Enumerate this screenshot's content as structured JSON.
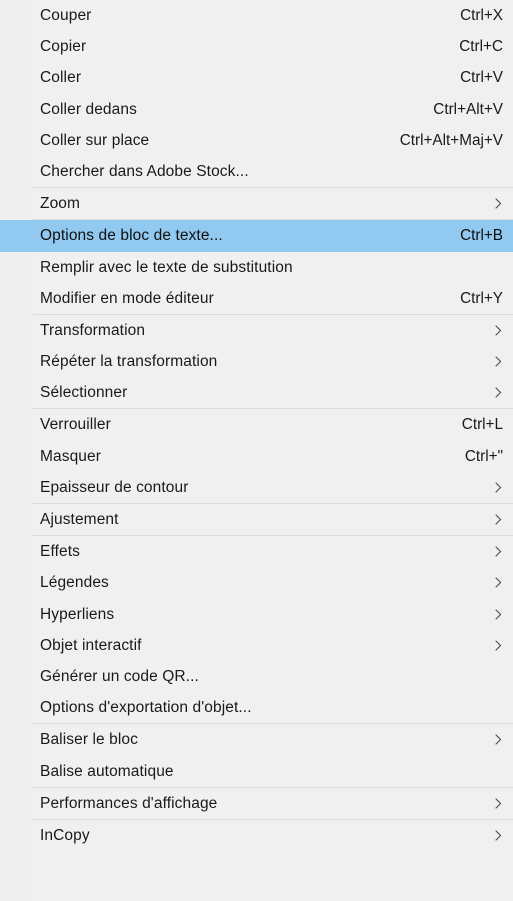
{
  "menu": {
    "type": "context-menu",
    "app": "Adobe InDesign",
    "language": "fr-FR",
    "background_color": "#f0f0f0",
    "highlight_color": "#91c9f0",
    "separator_color": "#dcdcdc",
    "text_color": "#1a1a1a",
    "chevron_glyph": "›",
    "items": [
      {
        "label": "Couper",
        "accel": "Ctrl+X",
        "submenu": false,
        "separator_after": false,
        "selected": false
      },
      {
        "label": "Copier",
        "accel": "Ctrl+C",
        "submenu": false,
        "separator_after": false,
        "selected": false
      },
      {
        "label": "Coller",
        "accel": "Ctrl+V",
        "submenu": false,
        "separator_after": false,
        "selected": false
      },
      {
        "label": "Coller dedans",
        "accel": "Ctrl+Alt+V",
        "submenu": false,
        "separator_after": false,
        "selected": false
      },
      {
        "label": "Coller sur place",
        "accel": "Ctrl+Alt+Maj+V",
        "submenu": false,
        "separator_after": false,
        "selected": false
      },
      {
        "label": "Chercher dans Adobe Stock...",
        "accel": "",
        "submenu": false,
        "separator_after": true,
        "selected": false
      },
      {
        "label": "Zoom",
        "accel": "",
        "submenu": true,
        "separator_after": true,
        "selected": false
      },
      {
        "label": "Options de bloc de texte...",
        "accel": "Ctrl+B",
        "submenu": false,
        "separator_after": false,
        "selected": true
      },
      {
        "label": "Remplir avec le texte de substitution",
        "accel": "",
        "submenu": false,
        "separator_after": false,
        "selected": false
      },
      {
        "label": "Modifier en mode éditeur",
        "accel": "Ctrl+Y",
        "submenu": false,
        "separator_after": true,
        "selected": false
      },
      {
        "label": "Transformation",
        "accel": "",
        "submenu": true,
        "separator_after": false,
        "selected": false
      },
      {
        "label": "Répéter la transformation",
        "accel": "",
        "submenu": true,
        "separator_after": false,
        "selected": false
      },
      {
        "label": "Sélectionner",
        "accel": "",
        "submenu": true,
        "separator_after": true,
        "selected": false
      },
      {
        "label": "Verrouiller",
        "accel": "Ctrl+L",
        "submenu": false,
        "separator_after": false,
        "selected": false
      },
      {
        "label": "Masquer",
        "accel": "Ctrl+\"",
        "submenu": false,
        "separator_after": false,
        "selected": false
      },
      {
        "label": "Epaisseur de contour",
        "accel": "",
        "submenu": true,
        "separator_after": true,
        "selected": false
      },
      {
        "label": "Ajustement",
        "accel": "",
        "submenu": true,
        "separator_after": true,
        "selected": false
      },
      {
        "label": "Effets",
        "accel": "",
        "submenu": true,
        "separator_after": false,
        "selected": false
      },
      {
        "label": "Légendes",
        "accel": "",
        "submenu": true,
        "separator_after": false,
        "selected": false
      },
      {
        "label": "Hyperliens",
        "accel": "",
        "submenu": true,
        "separator_after": false,
        "selected": false
      },
      {
        "label": "Objet interactif",
        "accel": "",
        "submenu": true,
        "separator_after": false,
        "selected": false
      },
      {
        "label": "Générer un code QR...",
        "accel": "",
        "submenu": false,
        "separator_after": false,
        "selected": false
      },
      {
        "label": "Options d'exportation d'objet...",
        "accel": "",
        "submenu": false,
        "separator_after": true,
        "selected": false
      },
      {
        "label": "Baliser le bloc",
        "accel": "",
        "submenu": true,
        "separator_after": false,
        "selected": false
      },
      {
        "label": "Balise automatique",
        "accel": "",
        "submenu": false,
        "separator_after": true,
        "selected": false
      },
      {
        "label": "Performances d'affichage",
        "accel": "",
        "submenu": true,
        "separator_after": true,
        "selected": false
      },
      {
        "label": "InCopy",
        "accel": "",
        "submenu": true,
        "separator_after": false,
        "selected": false
      }
    ]
  }
}
